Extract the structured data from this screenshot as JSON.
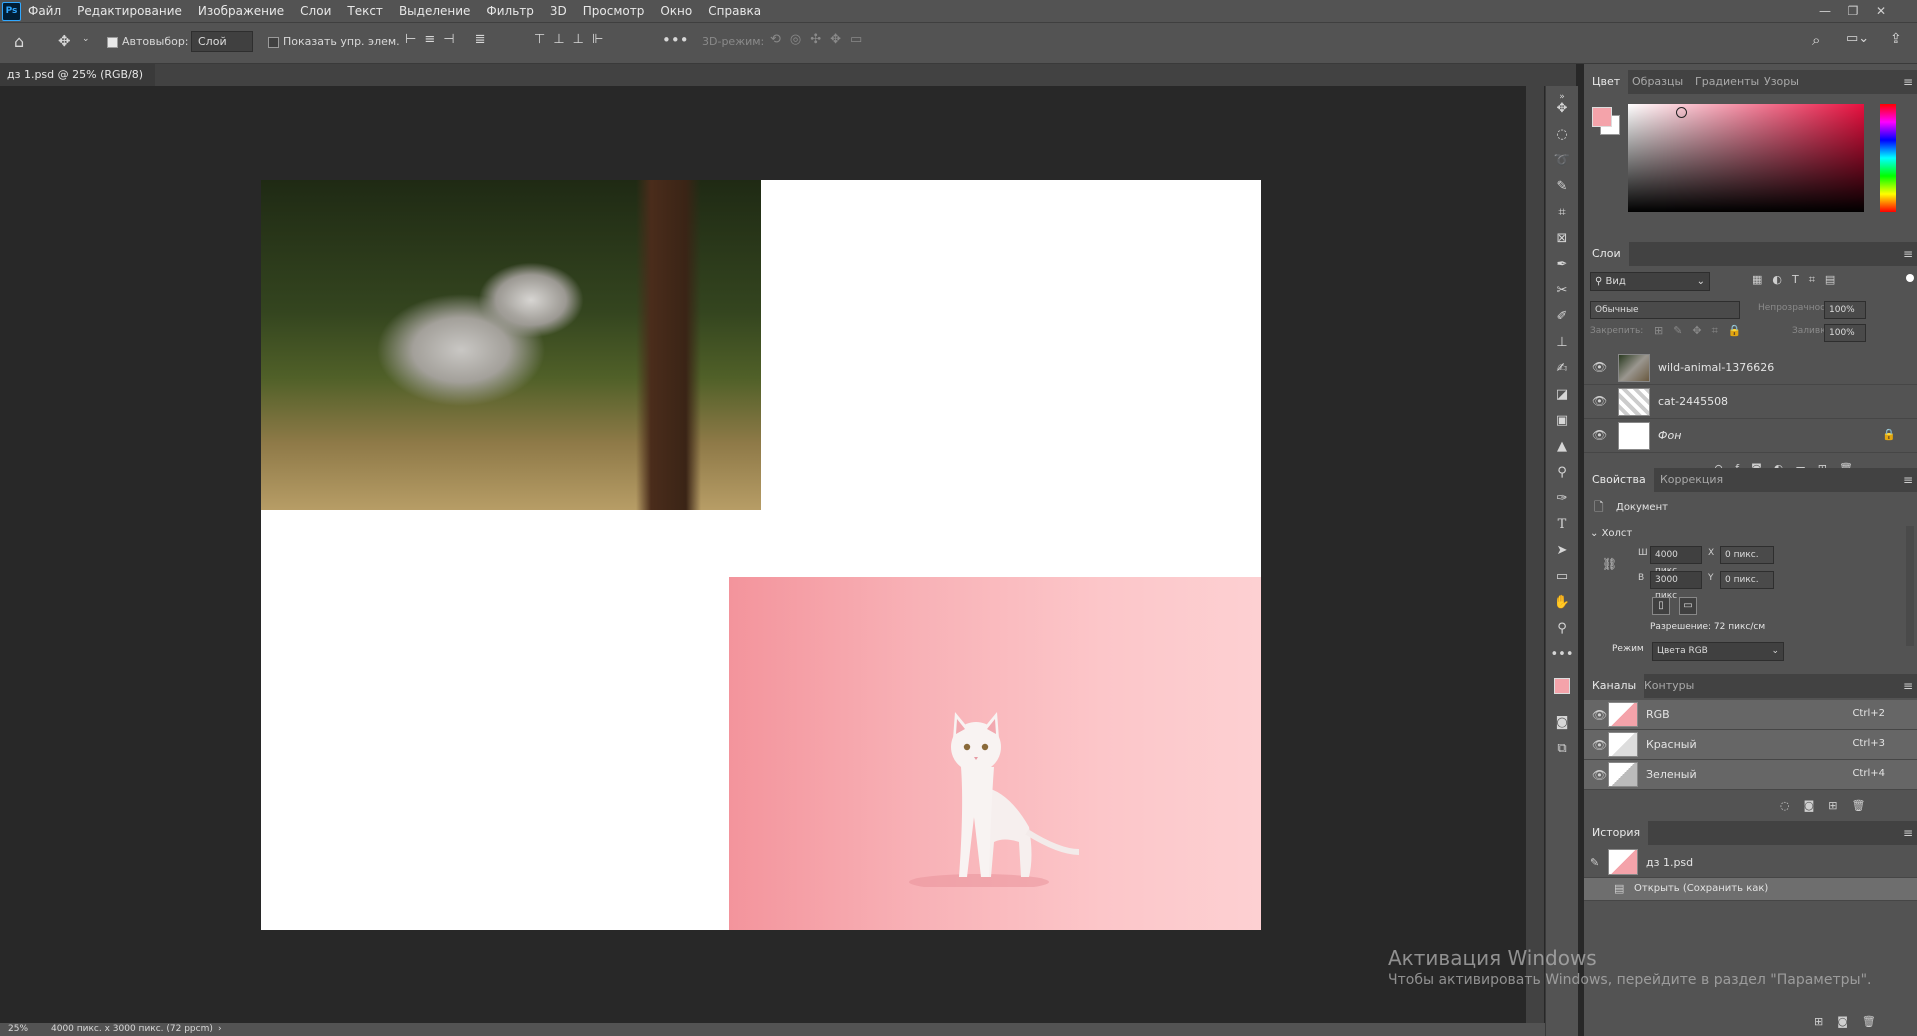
{
  "app": {
    "logo": "Ps"
  },
  "menu": [
    "Файл",
    "Редактирование",
    "Изображение",
    "Слои",
    "Текст",
    "Выделение",
    "Фильтр",
    "3D",
    "Просмотр",
    "Окно",
    "Справка"
  ],
  "options": {
    "autoselect": "Автовыбор:",
    "layer_select": "Слой",
    "show_transform": "Показать упр. элем.",
    "mode3d": "3D-режим:"
  },
  "document": {
    "tab_title": "дз 1.psd @ 25% (RGB/8)"
  },
  "status": {
    "zoom": "25%",
    "info": "4000 пикс. х 3000 пикс. (72 ppcm)"
  },
  "color_panel": {
    "tabs": [
      "Цвет",
      "Образцы",
      "Градиенты",
      "Узоры"
    ],
    "fg_color": "#f4a3aa",
    "bg_color": "#ffffff"
  },
  "layers_panel": {
    "title": "Слои",
    "filter": "Вид",
    "blend": "Обычные",
    "opacity_label": "Непрозрачность:",
    "opacity_value": "100%",
    "lock_label": "Закрепить:",
    "fill_label": "Заливка:",
    "fill_value": "100%",
    "layers": [
      "wild-animal-1376626",
      "cat-2445508",
      "Фон"
    ]
  },
  "properties_panel": {
    "tabs": [
      "Свойства",
      "Коррекция"
    ],
    "doc_label": "Документ",
    "canvas_section": "Холст",
    "w_label": "Ш",
    "w_value": "4000 пикс",
    "h_label": "В",
    "h_value": "3000 пикс",
    "x_label": "X",
    "x_placeholder": "0 пикс.",
    "y_label": "Y",
    "y_placeholder": "0 пикс.",
    "resolution": "Разрешение: 72 пикс/см",
    "mode_label": "Режим",
    "mode_value": "Цвета RGB"
  },
  "channels_panel": {
    "tabs": [
      "Каналы",
      "Контуры"
    ],
    "channels": [
      {
        "name": "RGB",
        "shortcut": "Ctrl+2"
      },
      {
        "name": "Красный",
        "shortcut": "Ctrl+3"
      },
      {
        "name": "Зеленый",
        "shortcut": "Ctrl+4"
      }
    ]
  },
  "history_panel": {
    "title": "История",
    "items": [
      "дз 1.psd",
      "Открыть (Сохранить как)"
    ]
  },
  "watermark": {
    "line1": "Активация Windows",
    "line2": "Чтобы активировать Windows, перейдите в раздел \"Параметры\"."
  }
}
